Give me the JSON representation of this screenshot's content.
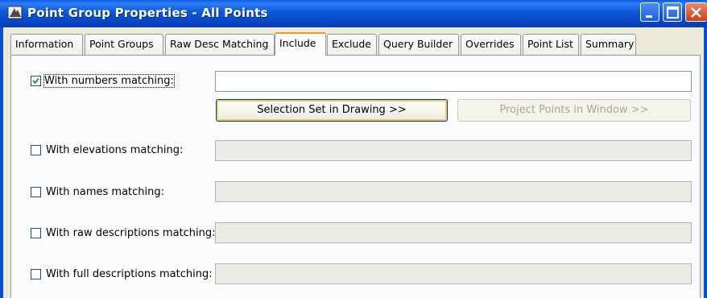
{
  "window": {
    "title": "Point Group Properties - All Points",
    "controls": [
      "minimize-icon",
      "maximize-icon",
      "close-icon"
    ]
  },
  "tabs": [
    {
      "label": "Information"
    },
    {
      "label": "Point Groups"
    },
    {
      "label": "Raw Desc Matching"
    },
    {
      "label": "Include",
      "active": true
    },
    {
      "label": "Exclude"
    },
    {
      "label": "Query Builder"
    },
    {
      "label": "Overrides"
    },
    {
      "label": "Point List"
    },
    {
      "label": "Summary"
    }
  ],
  "include": {
    "numbers": {
      "label": "With numbers matching:",
      "checked": true,
      "value": ""
    },
    "selection_button": "Selection Set in Drawing >>",
    "project_button": "Project Points in Window >>",
    "elevations": {
      "label": "With elevations matching:",
      "checked": false,
      "value": ""
    },
    "names": {
      "label": "With names matching:",
      "checked": false,
      "value": ""
    },
    "raw_descriptions": {
      "label": "With raw descriptions matching:",
      "checked": false,
      "value": ""
    },
    "full_descriptions": {
      "label": "With full descriptions matching:",
      "checked": false,
      "value": ""
    }
  },
  "colors": {
    "titlebar": "#0b58d8",
    "active_tab_accent": "#e89d28",
    "button_focus": "#f4c773"
  }
}
